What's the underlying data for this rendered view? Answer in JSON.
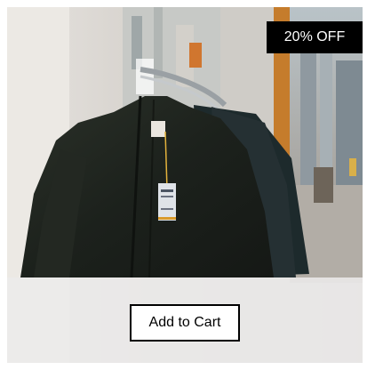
{
  "product": {
    "badge_text": "20% OFF",
    "add_to_cart_label": "Add to Cart",
    "image_subject": "dark jacket on clothing rack on street"
  },
  "colors": {
    "badge_bg": "#000000",
    "badge_text": "#ffffff",
    "button_border": "#000000",
    "overlay": "#ecebea"
  }
}
